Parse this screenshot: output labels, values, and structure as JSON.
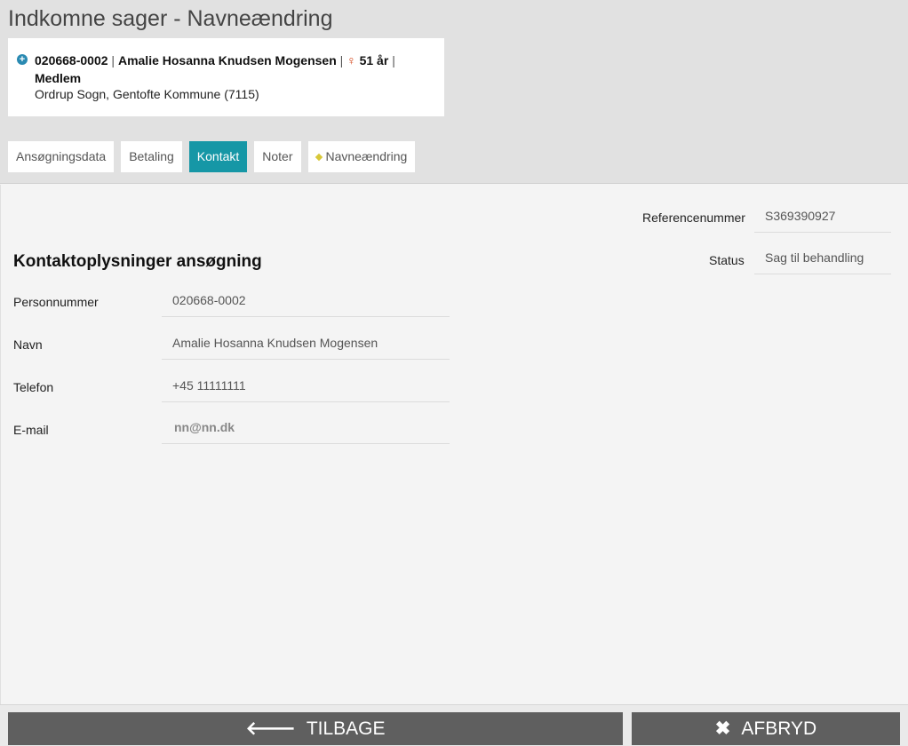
{
  "page": {
    "title": "Indkomne sager - Navneændring"
  },
  "person": {
    "cpr": "020668-0002",
    "name": "Amalie Hosanna Knudsen Mogensen",
    "age": "51 år",
    "membership": "Medlem",
    "parish": "Ordrup Sogn, Gentofte Kommune (7115)"
  },
  "tabs": [
    {
      "label": "Ansøgningsdata"
    },
    {
      "label": "Betaling"
    },
    {
      "label": "Kontakt"
    },
    {
      "label": "Noter"
    },
    {
      "label": "Navneændring"
    }
  ],
  "reference": {
    "label": "Referencenummer",
    "value": "S369390927"
  },
  "status": {
    "label": "Status",
    "value": "Sag til behandling"
  },
  "contact": {
    "section_title": "Kontaktoplysninger ansøgning",
    "fields": [
      {
        "label": "Personnummer",
        "value": "020668-0002"
      },
      {
        "label": "Navn",
        "value": "Amalie Hosanna Knudsen Mogensen"
      },
      {
        "label": "Telefon",
        "value": "+45 11111111"
      },
      {
        "label": "E-mail",
        "value": "nn@nn.dk"
      }
    ]
  },
  "footer": {
    "back_label": "TILBAGE",
    "cancel_label": "AFBRYD"
  },
  "colors": {
    "accent": "#1697a6",
    "button": "#5f5f5f"
  }
}
